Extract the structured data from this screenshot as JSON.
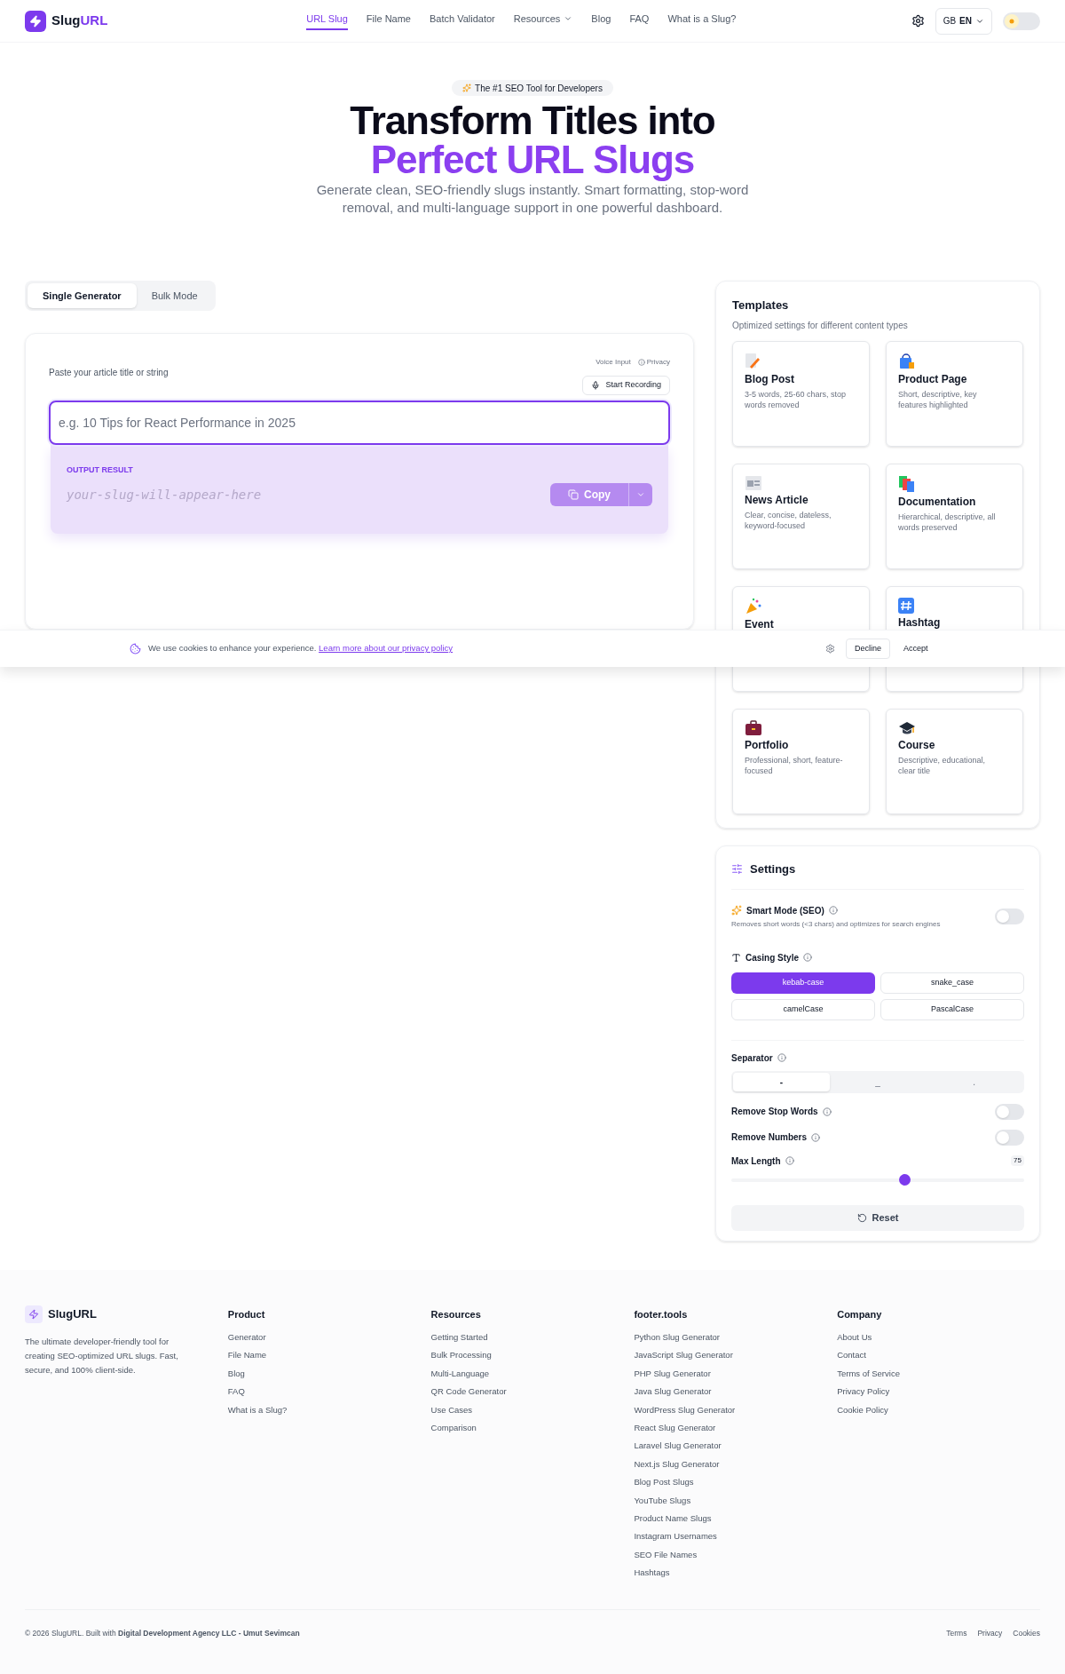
{
  "header": {
    "logo": {
      "part1": "Slug",
      "part2": "URL"
    },
    "nav": [
      {
        "label": "URL Slug",
        "selected": true,
        "dropdown": false
      },
      {
        "label": "File Name",
        "selected": false,
        "dropdown": false
      },
      {
        "label": "Batch Validator",
        "selected": false,
        "dropdown": false
      },
      {
        "label": "Resources",
        "selected": false,
        "dropdown": true
      },
      {
        "label": "Blog",
        "selected": false,
        "dropdown": false
      },
      {
        "label": "FAQ",
        "selected": false,
        "dropdown": false
      },
      {
        "label": "What is a Slug?",
        "selected": false,
        "dropdown": false
      }
    ],
    "language": {
      "flag": "GB",
      "code": "EN"
    },
    "theme_toggle": {
      "on": false
    }
  },
  "hero": {
    "badge": "The #1 SEO Tool for Developers",
    "title_line1": "Transform Titles into",
    "title_line2": "Perfect URL Slugs",
    "subtitle": "Generate clean, SEO-friendly slugs instantly. Smart formatting, stop-word removal, and multi-language support in one powerful dashboard."
  },
  "mode_tabs": [
    {
      "label": "Single Generator",
      "selected": true
    },
    {
      "label": "Bulk Mode",
      "selected": false
    }
  ],
  "generator": {
    "input_label": "Paste your article title or string",
    "voice_label": "Voice Input",
    "privacy": "Privacy",
    "record_button": "Start Recording",
    "input": {
      "placeholder": "e.g. 10 Tips for React Performance in 2025"
    },
    "output_label": "OUTPUT RESULT",
    "output_placeholder": "your-slug-will-appear-here",
    "copy_button": "Copy",
    "copy_disabled": true
  },
  "templates": {
    "title": "Templates",
    "subtitle": "Optimized settings for different content types",
    "items": [
      {
        "name": "Blog Post",
        "description": "3-5 words, 25-60 chars, stop words removed"
      },
      {
        "name": "Product Page",
        "description": "Short, descriptive, key features highlighted"
      },
      {
        "name": "News Article",
        "description": "Clear, concise, dateless, keyword-focused"
      },
      {
        "name": "Documentation",
        "description": "Hierarchical, descriptive, all words preserved"
      },
      {
        "name": "Event"
      },
      {
        "name": "Hashtag"
      },
      {
        "name": "Portfolio",
        "description": "Professional, short, feature-focused"
      },
      {
        "name": "Course",
        "description": "Descriptive, educational, clear title"
      }
    ]
  },
  "settings": {
    "title": "Settings",
    "smart_mode": {
      "label": "Smart Mode (SEO)",
      "description": "Removes short words (<3 chars) and optimizes for search engines",
      "on": false
    },
    "casing": {
      "label": "Casing Style",
      "options": [
        {
          "label": "kebab-case",
          "selected": true
        },
        {
          "label": "snake_case",
          "selected": false
        },
        {
          "label": "camelCase",
          "selected": false
        },
        {
          "label": "PascalCase",
          "selected": false
        }
      ]
    },
    "separator": {
      "label": "Separator",
      "options": [
        {
          "label": "-",
          "selected": true
        },
        {
          "label": "_",
          "selected": false
        },
        {
          "label": ".",
          "selected": false
        }
      ]
    },
    "toggles": [
      {
        "label": "Remove Stop Words",
        "on": false
      },
      {
        "label": "Remove Numbers",
        "on": false
      }
    ],
    "max_length": {
      "label": "Max Length",
      "value": "75",
      "level": 0.59
    },
    "reset_button": "Reset"
  },
  "cookie_banner": {
    "text": "We use cookies to enhance your experience.",
    "link": "Learn more about our privacy policy",
    "decline": "Decline",
    "accept": "Accept"
  },
  "footer": {
    "brand": "SlugURL",
    "tagline": "The ultimate developer-friendly tool for creating SEO-optimized URL slugs. Fast, secure, and 100% client-side.",
    "columns": [
      {
        "title": "Product",
        "links": [
          "Generator",
          "File Name",
          "Blog",
          "FAQ",
          "What is a Slug?"
        ]
      },
      {
        "title": "Resources",
        "links": [
          "Getting Started",
          "Bulk Processing",
          "Multi-Language",
          "QR Code Generator",
          "Use Cases",
          "Comparison"
        ]
      },
      {
        "title": "footer.tools",
        "links": [
          "Python Slug Generator",
          "JavaScript Slug Generator",
          "PHP Slug Generator",
          "Java Slug Generator",
          "WordPress Slug Generator",
          "React Slug Generator",
          "Laravel Slug Generator",
          "Next.js Slug Generator",
          "Blog Post Slugs",
          "YouTube Slugs",
          "Product Name Slugs",
          "Instagram Usernames",
          "SEO File Names",
          "Hashtags"
        ]
      },
      {
        "title": "Company",
        "links": [
          "About Us",
          "Contact",
          "Terms of Service",
          "Privacy Policy",
          "Cookie Policy"
        ]
      }
    ],
    "copyright": "© 2026 SlugURL. Built with **Digital Development Agency LLC - Umut Sevimcan**",
    "legal_links": [
      "Terms",
      "Privacy",
      "Cookies"
    ]
  }
}
